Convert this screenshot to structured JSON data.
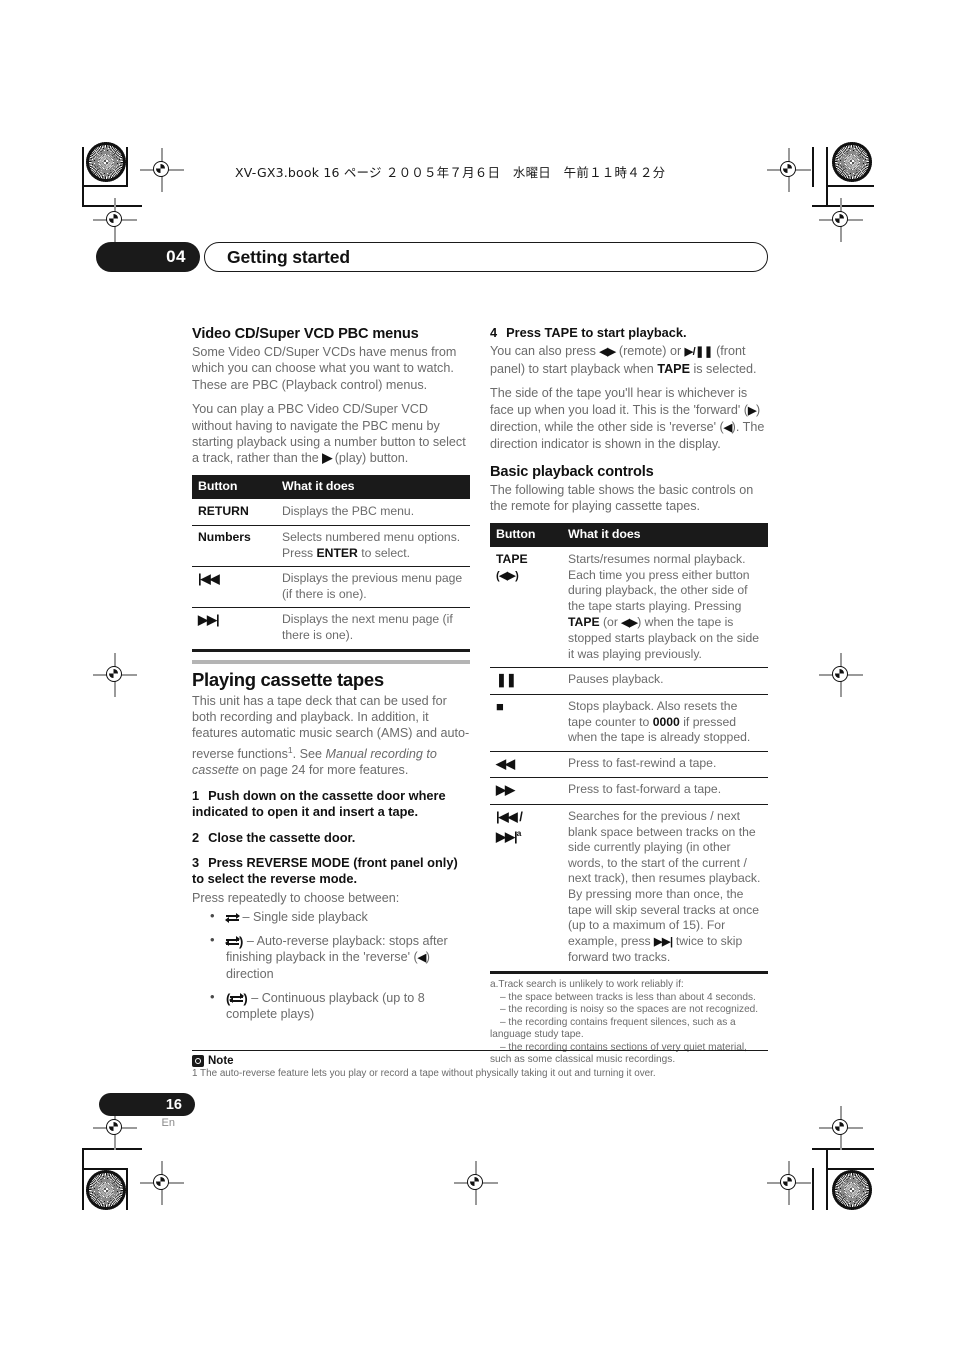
{
  "header": {
    "book_line": "XV-GX3.book  16 ページ  ２００５年７月６日　水曜日　午前１１時４２分"
  },
  "chapter": {
    "number": "04",
    "title": "Getting started"
  },
  "left_column": {
    "section1": {
      "heading": "Video CD/Super VCD PBC menus",
      "para1": "Some Video CD/Super VCDs have menus from which you can choose what you want to watch. These are PBC (Playback control) menus.",
      "para2_a": "You can play a PBC Video CD/Super VCD without having to navigate the PBC menu by starting playback using a number button to select a track, rather than the ",
      "para2_play_icon": "▶",
      "para2_b": " (play) button."
    },
    "pbc_table": {
      "headers": [
        "Button",
        "What it does"
      ],
      "rows": [
        {
          "button": "RETURN",
          "button_icon": "",
          "desc_a": "Displays the PBC menu.",
          "desc_bold": "",
          "desc_b": ""
        },
        {
          "button": "Numbers",
          "button_icon": "",
          "desc_a": "Selects numbered menu options. Press ",
          "desc_bold": "ENTER",
          "desc_b": " to select."
        },
        {
          "button": "",
          "button_icon": "◀◀",
          "button_icon_prefix": "|",
          "desc_a": "Displays the previous menu page (if there is one).",
          "desc_bold": "",
          "desc_b": ""
        },
        {
          "button": "",
          "button_icon": "▶▶",
          "button_icon_suffix": "|",
          "desc_a": "Displays the next menu page (if there is one).",
          "desc_bold": "",
          "desc_b": ""
        }
      ]
    },
    "section2": {
      "heading": "Playing cassette tapes",
      "para1_a": "This unit has a tape deck that can be used for both recording and playback. In addition, it features automatic music search (AMS) and auto-reverse functions",
      "para1_footnote_marker": "1",
      "para1_b": ". See ",
      "para1_italic": "Manual recording to cassette",
      "para1_c": " on page 24 for more features.",
      "step1": {
        "n": "1",
        "text": "Push down on the cassette door where indicated to open it and insert a tape."
      },
      "step2": {
        "n": "2",
        "text": "Close the cassette door."
      },
      "step3": {
        "n": "3",
        "text": "Press REVERSE MODE (front panel only) to select the reverse mode."
      },
      "step3_lead": "Press repeatedly to choose between:",
      "bullets": [
        {
          "icon": "reverse-mode-single",
          "text": "– Single side playback"
        },
        {
          "icon": "reverse-mode-auto",
          "text_a": "– Auto-reverse playback: stops after finishing playback in the 'reverse' (",
          "text_icon": "◀",
          "text_b": ") direction"
        },
        {
          "icon": "reverse-mode-continuous",
          "text": "– Continuous playback (up to 8 complete plays)"
        }
      ]
    }
  },
  "right_column": {
    "step4": {
      "n": "4",
      "text": "Press TAPE to start playback.",
      "para1_a": "You can also press ",
      "para1_icon1": "◀▶",
      "para1_b": " (remote) or ",
      "para1_icon2": "▶/❚❚",
      "para1_c": " (front panel) to start playback when ",
      "para1_bold": "TAPE",
      "para1_d": " is selected.",
      "para2_a": "The side of the tape you'll hear is whichever is face up when you load it. This is the 'forward' (",
      "para2_icon1": "▶",
      "para2_b": ") direction, while the other side is 'reverse' (",
      "para2_icon2": "◀",
      "para2_c": "). The direction indicator is shown in the display."
    },
    "section3": {
      "heading": "Basic playback controls",
      "para1": "The following table shows the basic controls on the remote for playing cassette tapes."
    },
    "controls_table": {
      "headers": [
        "Button",
        "What it does"
      ],
      "rows": [
        {
          "button_label": "TAPE",
          "button_sub": "(◀▶)",
          "desc_a": "Starts/resumes normal playback. Each time you press either button during playback, the other side of the tape starts playing. Pressing ",
          "desc_bold": "TAPE",
          "desc_b": " (or ",
          "desc_icon": "◀▶",
          "desc_c": ") when the tape is stopped starts playback on the side it was playing previously."
        },
        {
          "button_icon": "pause-icon",
          "desc_a": "Pauses playback.",
          "desc_bold": "",
          "desc_b": ""
        },
        {
          "button_icon": "stop-icon",
          "desc_a": "Stops playback. Also resets the tape counter to ",
          "desc_bold": "0000",
          "desc_b": " if pressed when the tape is already stopped."
        },
        {
          "button_icon": "rewind-icon",
          "desc_a": "Press to fast-rewind a tape.",
          "desc_bold": "",
          "desc_b": ""
        },
        {
          "button_icon": "fastforward-icon",
          "desc_a": "Press to fast-forward a tape.",
          "desc_bold": "",
          "desc_b": ""
        },
        {
          "button_icon": "skip-prev-next-icon",
          "button_footnote": "a",
          "desc_a": "Searches for the previous / next blank space between tracks on the side currently playing (in other words, to the start of the current / next track), then resumes playback.",
          "desc_para2_a": "By pressing more than once, the tape will skip several tracks at once (up to a maximum of 15). For example, press ",
          "desc_para2_icon": "▶▶|",
          "desc_para2_b": " twice to skip forward two tracks."
        }
      ]
    },
    "table_footnote": {
      "lead": "a.Track search is unlikely to work reliably if:",
      "items": [
        "– the space between tracks is less than about 4 seconds.",
        "– the recording is noisy so the spaces are not recognized.",
        "– the recording contains frequent silences, such as a language study tape.",
        "– the recording contains sections of very quiet material, such as some classical music recordings."
      ]
    }
  },
  "note": {
    "label": "Note",
    "icon": "note-icon",
    "text": "1 The auto-reverse feature lets you play or record a tape without physically taking it out and turning it over."
  },
  "footer": {
    "page_number": "16",
    "language": "En"
  },
  "colors": {
    "ink_black": "#1a1a1a",
    "body_gray": "#6b6b6b",
    "rule_gray": "#b4b4b4"
  }
}
